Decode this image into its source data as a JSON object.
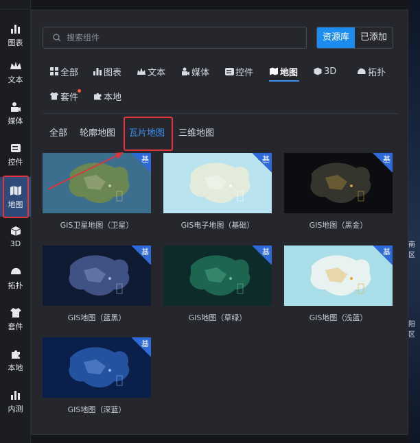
{
  "rail": {
    "items": [
      {
        "label": "图表",
        "icon": "bar-chart-icon"
      },
      {
        "label": "文本",
        "icon": "crown-icon"
      },
      {
        "label": "媒体",
        "icon": "camera-icon"
      },
      {
        "label": "控件",
        "icon": "control-icon"
      },
      {
        "label": "地图",
        "icon": "map-icon"
      },
      {
        "label": "3D",
        "icon": "cube-icon"
      },
      {
        "label": "拓扑",
        "icon": "topology-icon"
      },
      {
        "label": "套件",
        "icon": "shirt-icon"
      },
      {
        "label": "本地",
        "icon": "puzzle-icon"
      },
      {
        "label": "内测",
        "icon": "bar-chart-icon"
      }
    ],
    "active": "地图"
  },
  "search": {
    "placeholder": "搜索组件"
  },
  "source_toggle": {
    "options": [
      "资源库",
      "已添加"
    ],
    "selected": "资源库"
  },
  "categories": [
    {
      "label": "全部",
      "icon": "grid-icon"
    },
    {
      "label": "图表",
      "icon": "bar-chart-icon"
    },
    {
      "label": "文本",
      "icon": "crown-icon"
    },
    {
      "label": "媒体",
      "icon": "camera-icon"
    },
    {
      "label": "控件",
      "icon": "control-icon"
    },
    {
      "label": "地图",
      "icon": "map-icon"
    },
    {
      "label": "3D",
      "icon": "cube-icon"
    },
    {
      "label": "拓扑",
      "icon": "topology-icon"
    },
    {
      "label": "套件",
      "icon": "shirt-icon"
    },
    {
      "label": "本地",
      "icon": "puzzle-icon"
    }
  ],
  "active_category": "地图",
  "subtabs": [
    "全部",
    "轮廓地图",
    "瓦片地图",
    "三维地图"
  ],
  "active_subtab": "瓦片地图",
  "badge_text": "基",
  "cards": [
    {
      "title": "GIS卫星地图（卫星）",
      "theme": "satellite",
      "colors": [
        "#3c6e8e",
        "#6f8a4a",
        "#c9c3a6"
      ]
    },
    {
      "title": "GIS电子地图（基础）",
      "theme": "basic",
      "colors": [
        "#b9e3ef",
        "#e8ecd8",
        "#ffffff"
      ]
    },
    {
      "title": "GIS地图（黑金）",
      "theme": "black-gold",
      "colors": [
        "#0b0d10",
        "#3a3a32",
        "#c9a33c"
      ]
    },
    {
      "title": "GIS地图（蓝黑）",
      "theme": "blue-black",
      "colors": [
        "#0f1a33",
        "#46598c",
        "#9fb3e0"
      ]
    },
    {
      "title": "GIS地图（草绿）",
      "theme": "grass-green",
      "colors": [
        "#0d2b2a",
        "#1f6b55",
        "#5fc79a"
      ]
    },
    {
      "title": "GIS地图（浅蓝）",
      "theme": "light-blue",
      "colors": [
        "#a9dde8",
        "#eef4f1",
        "#e7a62a"
      ]
    },
    {
      "title": "GIS地图（深蓝）",
      "theme": "deep-blue",
      "colors": [
        "#0a1f4a",
        "#2758a8",
        "#8fb8ff"
      ]
    }
  ],
  "background_map_labels": [
    "南区",
    "阳区"
  ]
}
